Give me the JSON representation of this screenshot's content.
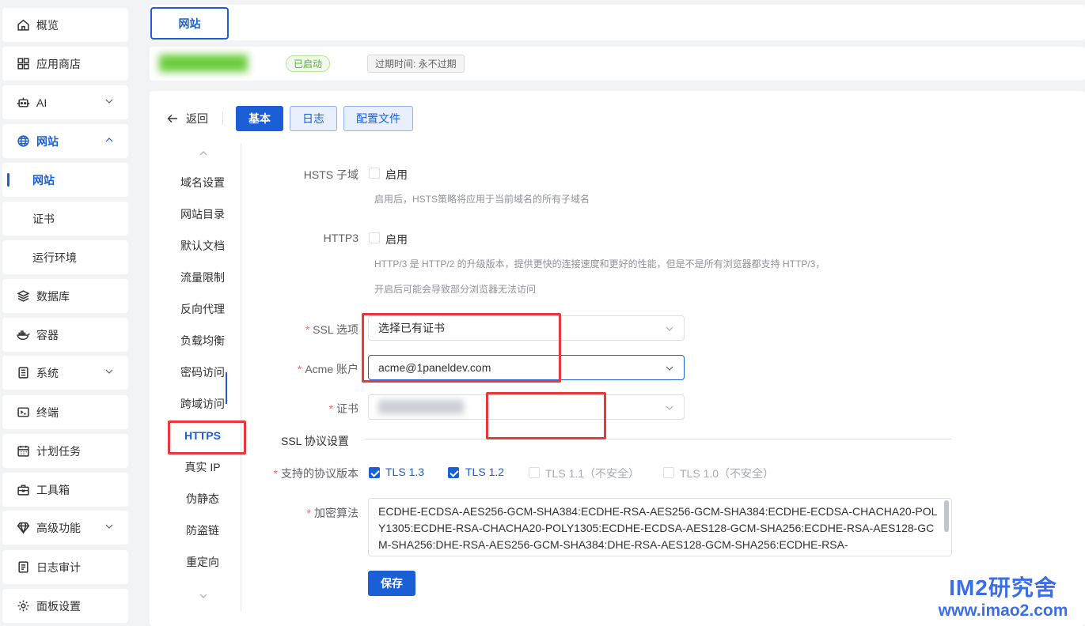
{
  "sidebar": {
    "items": [
      {
        "label": "概览",
        "icon": "home-icon"
      },
      {
        "label": "应用商店",
        "icon": "grid-icon"
      },
      {
        "label": "AI",
        "icon": "robot-icon"
      },
      {
        "label": "网站",
        "icon": "globe-icon"
      },
      {
        "label": "网站"
      },
      {
        "label": "证书"
      },
      {
        "label": "运行环境"
      },
      {
        "label": "数据库",
        "icon": "layers-icon"
      },
      {
        "label": "容器",
        "icon": "docker-icon"
      },
      {
        "label": "系统",
        "icon": "server-icon"
      },
      {
        "label": "终端",
        "icon": "terminal-icon"
      },
      {
        "label": "计划任务",
        "icon": "calendar-icon"
      },
      {
        "label": "工具箱",
        "icon": "toolbox-icon"
      },
      {
        "label": "高级功能",
        "icon": "diamond-icon"
      },
      {
        "label": "日志审计",
        "icon": "log-icon"
      },
      {
        "label": "面板设置",
        "icon": "gear-icon"
      }
    ]
  },
  "tabs": {
    "website": "网站"
  },
  "status": {
    "badge": "已启动",
    "expire": "过期时间: 永不过期"
  },
  "toolbar": {
    "back": "返回",
    "basic": "基本",
    "log": "日志",
    "config": "配置文件"
  },
  "inner_menu": {
    "items": [
      "域名设置",
      "网站目录",
      "默认文档",
      "流量限制",
      "反向代理",
      "负载均衡",
      "密码访问",
      "跨域访问",
      "HTTPS",
      "真实 IP",
      "伪静态",
      "防盗链",
      "重定向"
    ],
    "active": "HTTPS"
  },
  "form": {
    "hsts_sub": {
      "label": "HSTS 子域",
      "check": "启用",
      "checked": false,
      "hint": "启用后，HSTS策略将应用于当前域名的所有子域名"
    },
    "http3": {
      "label": "HTTP3",
      "check": "启用",
      "checked": false,
      "hint1": "HTTP/3 是 HTTP/2 的升级版本，提供更快的连接速度和更好的性能，但是不是所有浏览器都支持 HTTP/3，",
      "hint2": "开启后可能会导致部分浏览器无法访问"
    },
    "ssl_option": {
      "label": "SSL 选项",
      "value": "选择已有证书"
    },
    "acme_account": {
      "label": "Acme 账户",
      "value": "acme@1paneldev.com"
    },
    "cert": {
      "label": "证书"
    },
    "section_title": "SSL 协议设置",
    "protocols": {
      "label": "支持的协议版本",
      "items": [
        {
          "name": "TLS 1.3",
          "checked": true
        },
        {
          "name": "TLS 1.2",
          "checked": true
        },
        {
          "name": "TLS 1.1（不安全）",
          "checked": false
        },
        {
          "name": "TLS 1.0（不安全）",
          "checked": false
        }
      ]
    },
    "cipher": {
      "label": "加密算法",
      "value": "ECDHE-ECDSA-AES256-GCM-SHA384:ECDHE-RSA-AES256-GCM-SHA384:ECDHE-ECDSA-CHACHA20-POLY1305:ECDHE-RSA-CHACHA20-POLY1305:ECDHE-ECDSA-AES128-GCM-SHA256:ECDHE-RSA-AES128-GCM-SHA256:DHE-RSA-AES256-GCM-SHA384:DHE-RSA-AES128-GCM-SHA256:ECDHE-RSA-"
    },
    "save": "保存"
  },
  "watermark": {
    "line1": "IM2研究舍",
    "line2": "www.imao2.com"
  },
  "colors": {
    "primary": "#1a5fd6",
    "success": "#52b530",
    "danger": "#e8393a",
    "required": "#f56c6c"
  }
}
